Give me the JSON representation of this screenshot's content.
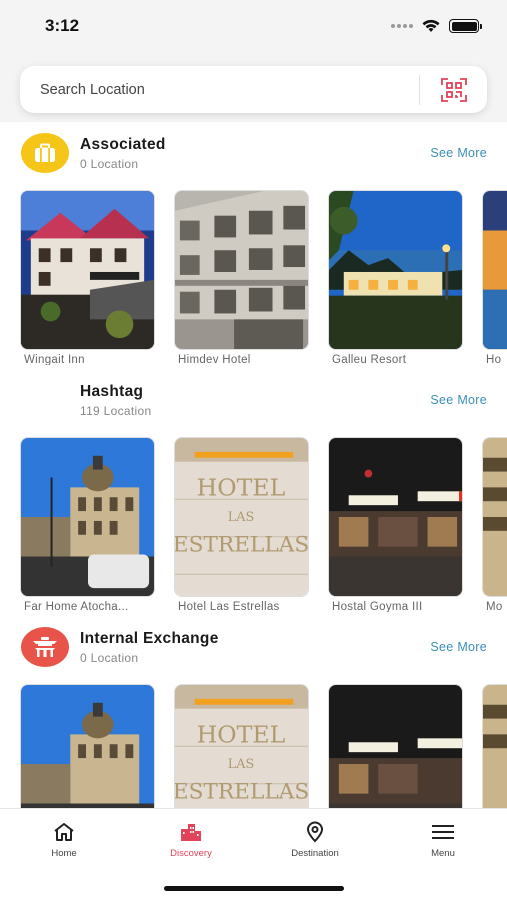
{
  "status": {
    "time": "3:12"
  },
  "search": {
    "placeholder": "Search Location"
  },
  "sections": [
    {
      "title": "Associated",
      "subtitle": "0 Location",
      "see_more": "See More",
      "icon": "briefcase-icon",
      "icon_bg": "#f5c518",
      "cards": [
        {
          "name": "Wingait Inn"
        },
        {
          "name": "Himdev Hotel"
        },
        {
          "name": "Galleu Resort"
        },
        {
          "name": "Ho"
        }
      ]
    },
    {
      "title": "Hashtag",
      "subtitle": "119 Location",
      "see_more": "See More",
      "cards": [
        {
          "name": "Far Home Atocha..."
        },
        {
          "name": "Hotel Las Estrellas"
        },
        {
          "name": "Hostal Goyma III"
        },
        {
          "name": "Mo"
        }
      ],
      "sign_text": {
        "line1": "HOTEL",
        "line2": "LAS",
        "line3": "ESTRELLAS"
      }
    },
    {
      "title": "Internal Exchange",
      "subtitle": "0 Location",
      "see_more": "See More",
      "icon": "pagoda-icon",
      "icon_bg": "#e8544a",
      "cards": [
        {
          "name": ""
        },
        {
          "name": ""
        },
        {
          "name": ""
        },
        {
          "name": ""
        }
      ]
    }
  ],
  "tabs": [
    {
      "label": "Home",
      "icon": "home-icon"
    },
    {
      "label": "Discovery",
      "icon": "city-icon",
      "active": true
    },
    {
      "label": "Destination",
      "icon": "location-pin-icon"
    },
    {
      "label": "Menu",
      "icon": "hamburger-icon"
    }
  ],
  "colors": {
    "accent": "#e0435a",
    "link": "#3a8fb7"
  }
}
